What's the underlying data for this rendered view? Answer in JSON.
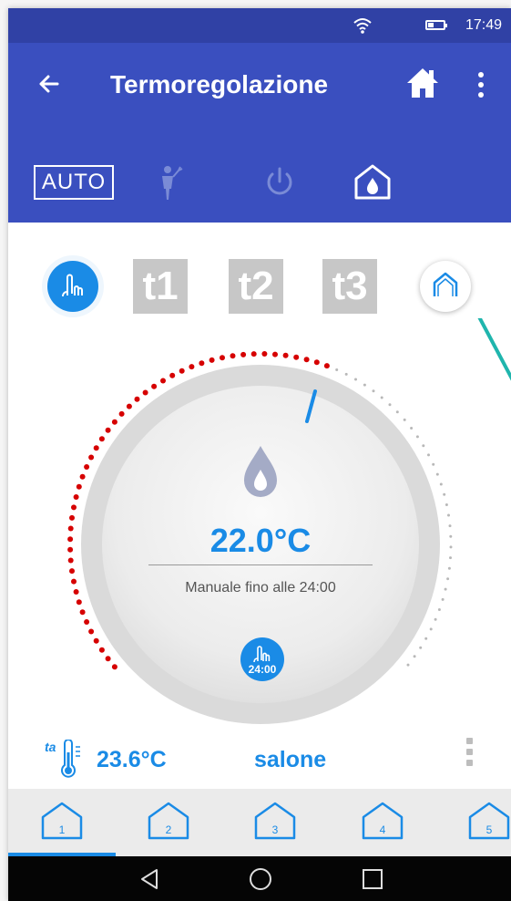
{
  "status_bar": {
    "time": "17:49",
    "battery_level": 0.35
  },
  "app_bar": {
    "title": "Termoregolazione"
  },
  "modes": {
    "auto_label": "AUTO"
  },
  "schedules": [
    "t1",
    "t2",
    "t3"
  ],
  "dial": {
    "setpoint": "22.0°C",
    "mode_text": "Manuale fino alle 24:00",
    "until_time": "24:00"
  },
  "ambient": {
    "label": "ta",
    "temperature": "23.6°C"
  },
  "zone": {
    "name": "salone"
  },
  "zone_tabs": [
    "1",
    "2",
    "3",
    "4",
    "5"
  ],
  "colors": {
    "header": "#3a4fbf",
    "status_bar": "#3041a5",
    "accent": "#1a8be6",
    "heating_arc": "#d60000",
    "schedule_inactive": "#c7c7c7",
    "connector": "#1fb5ad"
  }
}
